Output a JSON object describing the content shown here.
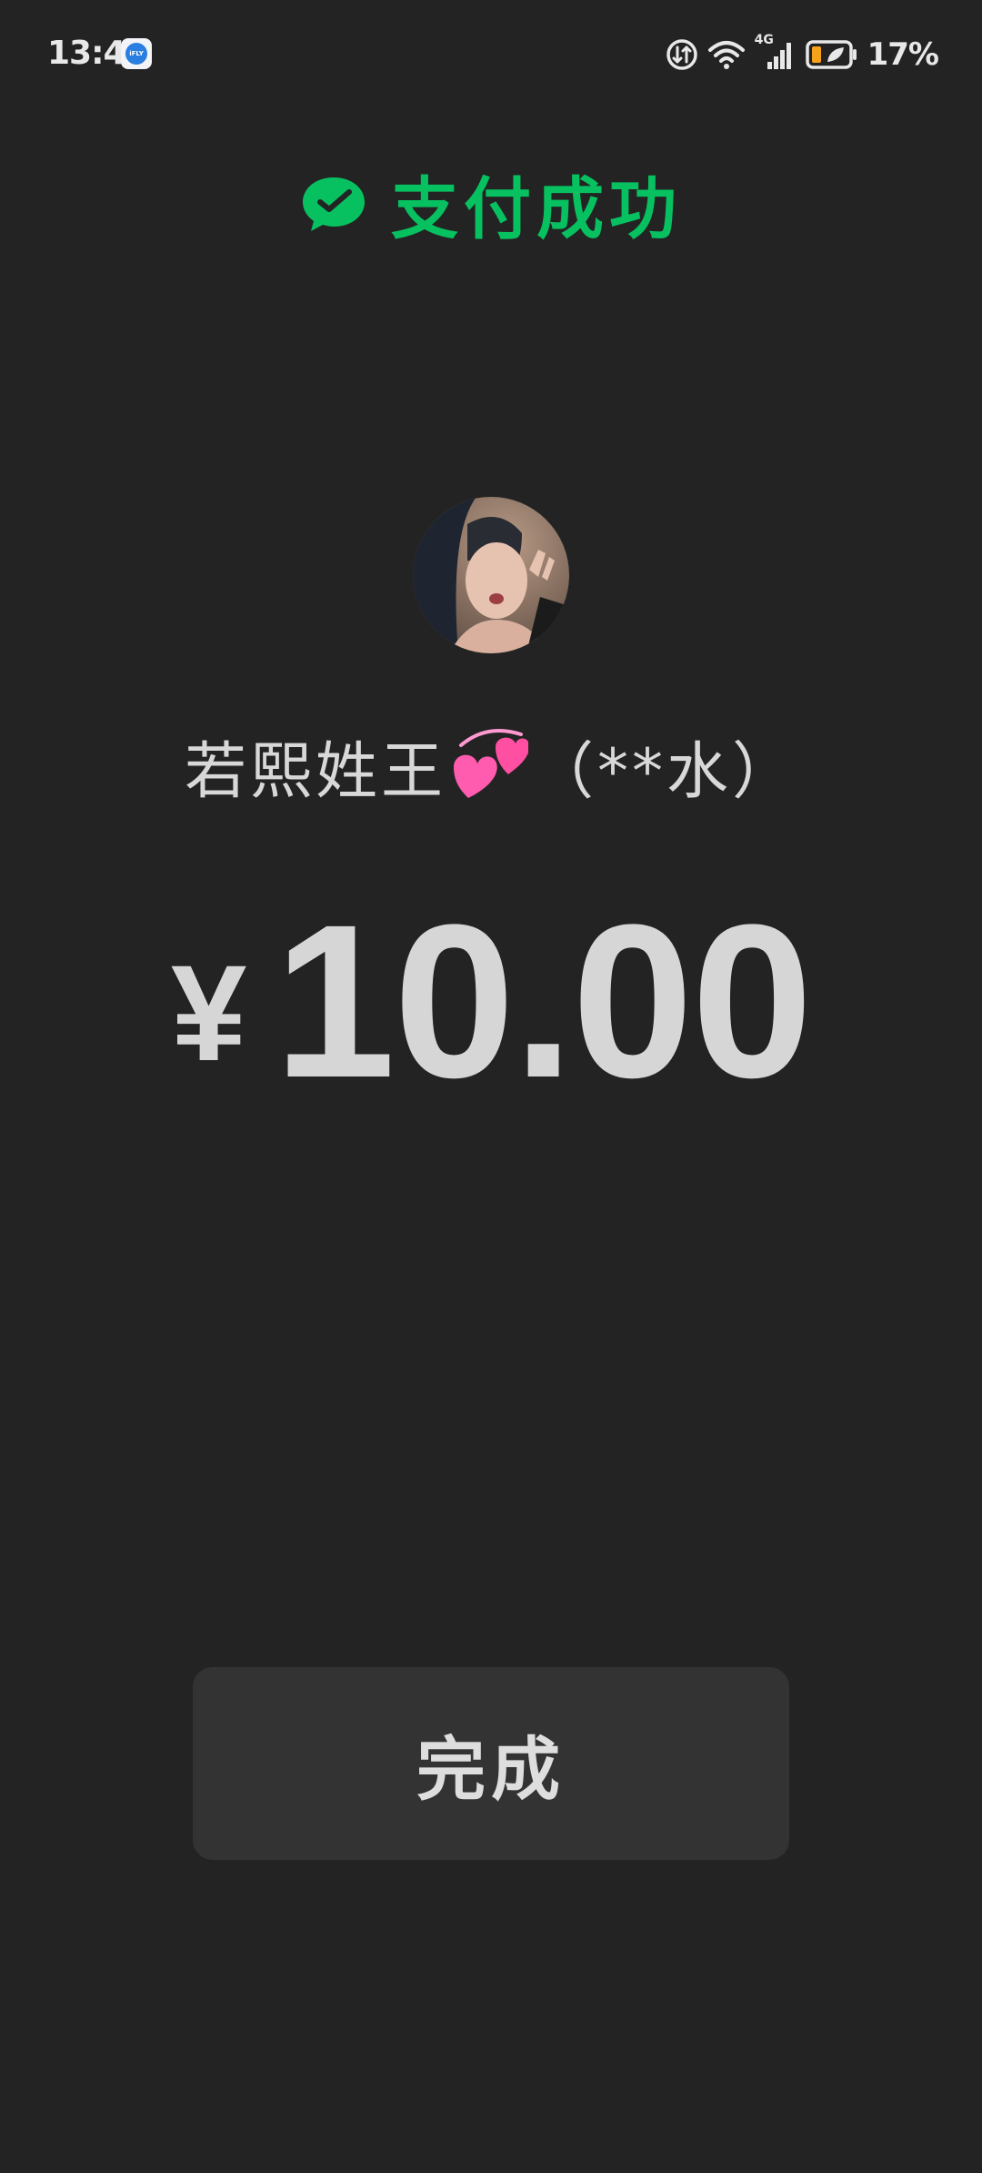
{
  "status_bar": {
    "time": "13:47",
    "app_badge_text": "iFLY",
    "network_label": "4G",
    "battery_percent": "17%",
    "battery_level": 0.17
  },
  "header": {
    "title": "支付成功",
    "icon": "wechat-pay-icon",
    "accent_color": "#07c160"
  },
  "payee": {
    "name": "若熙姓王",
    "emoji": "revolving-hearts-icon",
    "masked_name": "（**水）"
  },
  "payment": {
    "currency_symbol": "¥",
    "amount": "10.00"
  },
  "actions": {
    "done_label": "完成"
  }
}
